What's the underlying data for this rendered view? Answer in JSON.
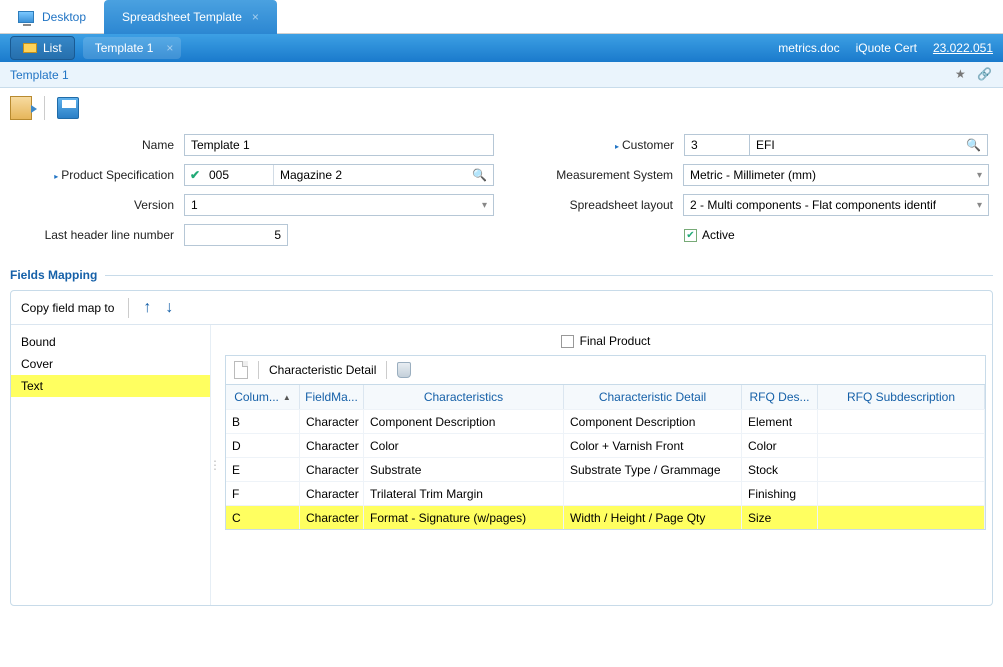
{
  "tabs": {
    "desktop": "Desktop",
    "spreadsheet": "Spreadsheet Template"
  },
  "header": {
    "list": "List",
    "template": "Template 1",
    "metrics": "metrics.doc",
    "iquote": "iQuote Cert",
    "version": "23.022.051"
  },
  "breadcrumb": "Template 1",
  "form": {
    "name_label": "Name",
    "name_value": "Template 1",
    "customer_label": "Customer",
    "customer_code": "3",
    "customer_name": "EFI",
    "prodspec_label": "Product Specification",
    "prodspec_code": "005",
    "prodspec_name": "Magazine 2",
    "measurement_label": "Measurement System",
    "measurement_value": "Metric - Millimeter (mm)",
    "version_label": "Version",
    "version_value": "1",
    "layout_label": "Spreadsheet layout",
    "layout_value": "2 - Multi components - Flat components identif",
    "lastheader_label": "Last header line number",
    "lastheader_value": "5",
    "active_label": "Active"
  },
  "section_title": "Fields Mapping",
  "copy_label": "Copy field map to",
  "left_items": [
    "Bound",
    "Cover",
    "Text"
  ],
  "final_label": "Final Product",
  "char_detail": "Characteristic Detail",
  "grid": {
    "headers": [
      "Colum...",
      "FieldMa...",
      "Characteristics",
      "Characteristic Detail",
      "RFQ Des...",
      "RFQ Subdescription"
    ],
    "rows": [
      {
        "c": "B",
        "f": "Character",
        "ch": "Component Description",
        "cd": "Component Description",
        "rd": "Element",
        "rs": ""
      },
      {
        "c": "D",
        "f": "Character",
        "ch": "Color",
        "cd": "Color + Varnish Front",
        "rd": "Color",
        "rs": ""
      },
      {
        "c": "E",
        "f": "Character",
        "ch": "Substrate",
        "cd": "Substrate Type / Grammage",
        "rd": "Stock",
        "rs": ""
      },
      {
        "c": "F",
        "f": "Character",
        "ch": "Trilateral Trim Margin",
        "cd": "",
        "rd": "Finishing",
        "rs": ""
      },
      {
        "c": "C",
        "f": "Character",
        "ch": "Format - Signature (w/pages)",
        "cd": "Width / Height / Page Qty",
        "rd": "Size",
        "rs": ""
      }
    ]
  }
}
